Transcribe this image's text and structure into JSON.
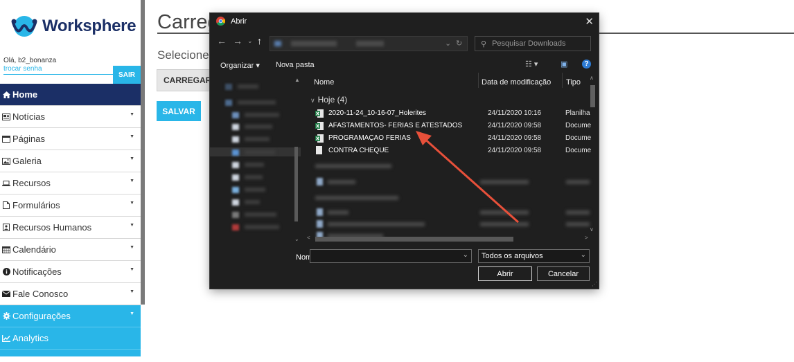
{
  "app": {
    "brand": "Worksphere",
    "greeting": "Olá, b2_bonanza",
    "change_password": "trocar senha",
    "logout": "SAIR",
    "colors": {
      "navy": "#1b2f66",
      "cyan": "#29b6e8"
    }
  },
  "sidebar": {
    "items": [
      {
        "label": "Home",
        "icon": "home-icon"
      },
      {
        "label": "Notícias",
        "icon": "newspaper-icon"
      },
      {
        "label": "Páginas",
        "icon": "window-icon"
      },
      {
        "label": "Galeria",
        "icon": "image-icon"
      },
      {
        "label": "Recursos",
        "icon": "laptop-icon"
      },
      {
        "label": "Formulários",
        "icon": "file-icon"
      },
      {
        "label": "Recursos Humanos",
        "icon": "id-badge-icon"
      },
      {
        "label": "Calendário",
        "icon": "calendar-icon"
      },
      {
        "label": "Notificações",
        "icon": "info-icon"
      },
      {
        "label": "Fale Conosco",
        "icon": "envelope-icon"
      },
      {
        "label": "Configurações",
        "icon": "gear-icon"
      },
      {
        "label": "Analytics",
        "icon": "chart-line-icon"
      }
    ]
  },
  "main": {
    "title": "Carreg",
    "subtitle": "Selecione",
    "upload_button": "CARREGAR A",
    "save_button": "SALVAR"
  },
  "dialog": {
    "title": "Abrir",
    "search_placeholder": "Pesquisar Downloads",
    "toolbar": {
      "organize": "Organizar ▾",
      "new_folder": "Nova pasta"
    },
    "columns": {
      "name": "Nome",
      "modified": "Data de modificação",
      "type": "Tipo"
    },
    "group": "Hoje (4)",
    "files": [
      {
        "name": "2020-11-24_10-16-07_Holerites",
        "modified": "24/11/2020 10:16",
        "type": "Planilha",
        "kind": "excel"
      },
      {
        "name": "AFASTAMENTOS- FERIAS E ATESTADOS",
        "modified": "24/11/2020 09:58",
        "type": "Documento",
        "kind": "excel"
      },
      {
        "name": "PROGRAMAÇAO FERIAS",
        "modified": "24/11/2020 09:58",
        "type": "Documento",
        "kind": "excel"
      },
      {
        "name": "CONTRA CHEQUE",
        "modified": "24/11/2020 09:58",
        "type": "Documento",
        "kind": "document"
      }
    ],
    "filename_label": "Nome:",
    "filename_value": "",
    "filetype": "Todos os arquivos",
    "open_button": "Abrir",
    "cancel_button": "Cancelar",
    "annotation_color": "#e8503a"
  }
}
